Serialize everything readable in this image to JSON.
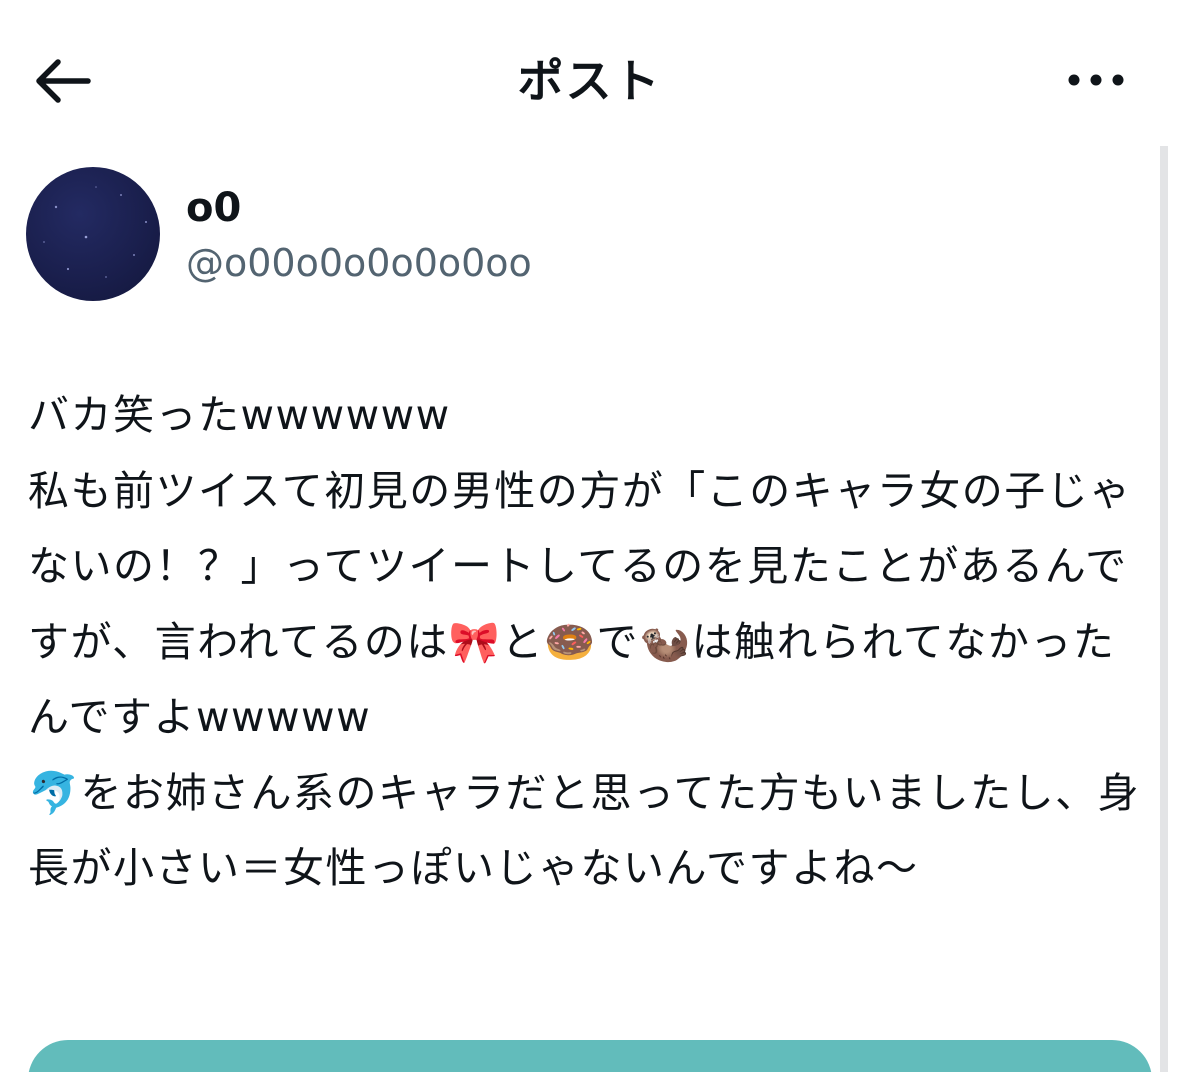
{
  "header": {
    "title": "ポスト",
    "back_icon": "arrow-left-icon",
    "more_icon": "more-horizontal-icon"
  },
  "author": {
    "display_name": "o0",
    "handle": "@o00o0o0o0o0oo"
  },
  "post": {
    "text": "バカ笑ったwwwwww\n私も前ツイスて初見の男性の方が「このキャラ女の子じゃないの！？」ってツイートしてるのを見たことがあるんですが、言われてるのは🎀と🍩で🦦は触れられてなかったんですよwwwww\n🐬をお姉さん系のキャラだと思ってた方もいましたし、身長が小さい＝女性っぽいじゃないんですよね〜"
  },
  "colors": {
    "text_primary": "#0f1419",
    "text_secondary": "#536471",
    "avatar_bg": "#1a1f4d",
    "card_accent": "#62bcbb"
  }
}
